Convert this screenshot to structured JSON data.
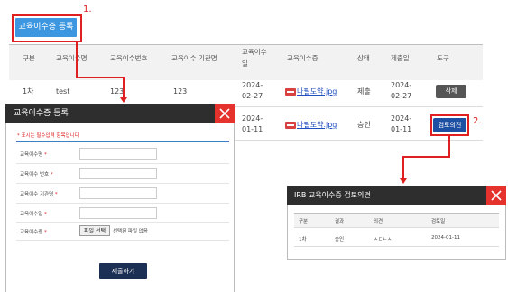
{
  "register_button_label": "교육이수증 등록",
  "annotation_1": "1.",
  "annotation_2": "2.",
  "table": {
    "headers": [
      "구분",
      "교육이수명",
      "교육이수번호",
      "교육이수 기관명",
      "교육이수일",
      "교육이수증",
      "상태",
      "제출일",
      "도구"
    ],
    "rows": [
      {
        "type": "1차",
        "name": "test",
        "number": "123",
        "institution": "123",
        "date": "2024-02-27",
        "file": "나필도약.jpg",
        "status": "제출",
        "submitted": "2024-02-27",
        "tool": "삭제"
      },
      {
        "type": "",
        "name": "",
        "number": "",
        "institution": "",
        "date": "2024-01-11",
        "file": "나필도약.jpg",
        "status": "승인",
        "submitted": "2024-01-11",
        "tool": "검토의견"
      }
    ]
  },
  "register_modal": {
    "title": "교육이수증 등록",
    "close_icon": "close-icon",
    "required_note": "* 표시는 필수입력 항목입니다",
    "fields": [
      {
        "label": "교육이수명",
        "required": "*"
      },
      {
        "label": "교육이수 번호",
        "required": "*"
      },
      {
        "label": "교육이수 기관명",
        "required": "*"
      },
      {
        "label": "교육이수일",
        "required": "*"
      },
      {
        "label": "교육이수증",
        "required": "*"
      }
    ],
    "file_button": "파일 선택",
    "file_none": "선택된 파일 없음",
    "submit": "제출하기"
  },
  "review_modal": {
    "title": "IRB 교육이수증 검토의견",
    "close_icon": "close-icon",
    "headers": [
      "구분",
      "결과",
      "의견",
      "검토일"
    ],
    "row": {
      "type": "1차",
      "result": "승인",
      "opinion": "ㅅㄷㄴㅅ",
      "date": "2024-01-11"
    }
  },
  "colors": {
    "accent_blue": "#3d97e0",
    "highlight_red": "#e02020",
    "modal_header": "#2e2e2e",
    "review_button": "#1d4fa3",
    "submit_button": "#1c2f55"
  }
}
